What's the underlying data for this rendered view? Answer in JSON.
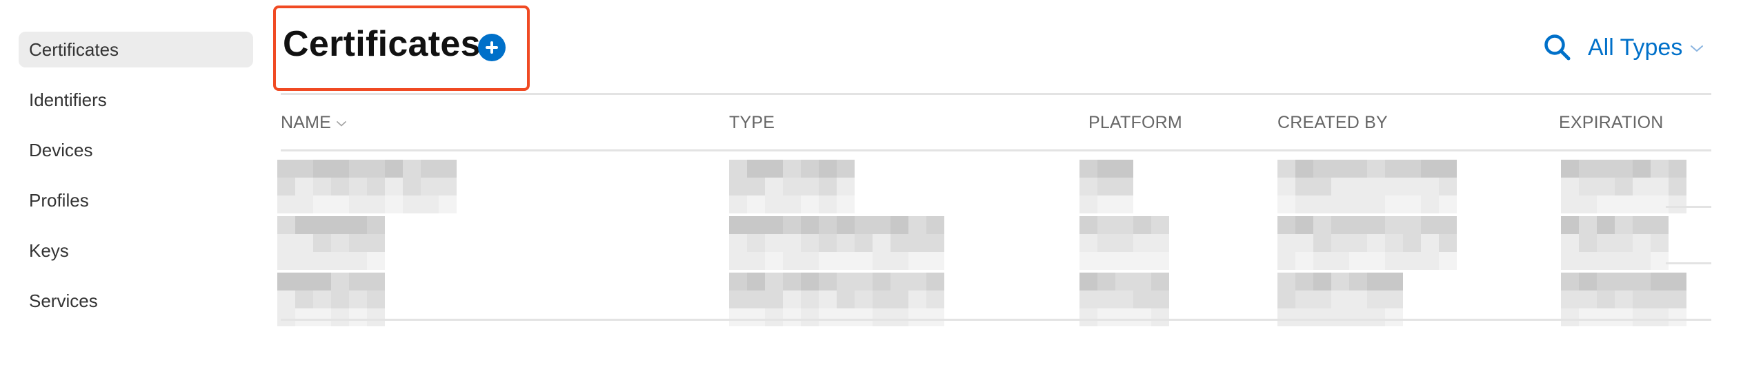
{
  "sidebar": {
    "items": [
      {
        "label": "Certificates",
        "active": true
      },
      {
        "label": "Identifiers",
        "active": false
      },
      {
        "label": "Devices",
        "active": false
      },
      {
        "label": "Profiles",
        "active": false
      },
      {
        "label": "Keys",
        "active": false
      },
      {
        "label": "Services",
        "active": false
      }
    ]
  },
  "header": {
    "title": "Certificates",
    "add_icon": "plus-circle-icon",
    "search_icon": "search-icon",
    "filter": {
      "selected": "All Types",
      "icon": "chevron-down-icon"
    }
  },
  "colors": {
    "accent": "#0070c9",
    "highlight_box": "#f04a23",
    "sidebar_active_bg": "#ececec",
    "divider": "#e3e3e3",
    "header_text": "#666666"
  },
  "table": {
    "columns": [
      {
        "key": "name",
        "label": "NAME",
        "sortable": true,
        "sort_icon": "chevron-down-icon"
      },
      {
        "key": "type",
        "label": "TYPE",
        "sortable": false
      },
      {
        "key": "platform",
        "label": "PLATFORM",
        "sortable": false
      },
      {
        "key": "created_by",
        "label": "CREATED BY",
        "sortable": false
      },
      {
        "key": "expiration",
        "label": "EXPIRATION",
        "sortable": false
      }
    ],
    "rows": [
      {
        "name": "[redacted]",
        "type": "[redacted]",
        "platform": "[redacted]",
        "created_by": "[redacted]",
        "expiration": "[redacted]"
      },
      {
        "name": "[redacted]",
        "type": "[redacted]",
        "platform": "[redacted]",
        "created_by": "[redacted]",
        "expiration": "[redacted]"
      },
      {
        "name": "[redacted]",
        "type": "[redacted]",
        "platform": "[redacted]",
        "created_by": "[redacted]",
        "expiration": "[redacted]"
      }
    ]
  }
}
